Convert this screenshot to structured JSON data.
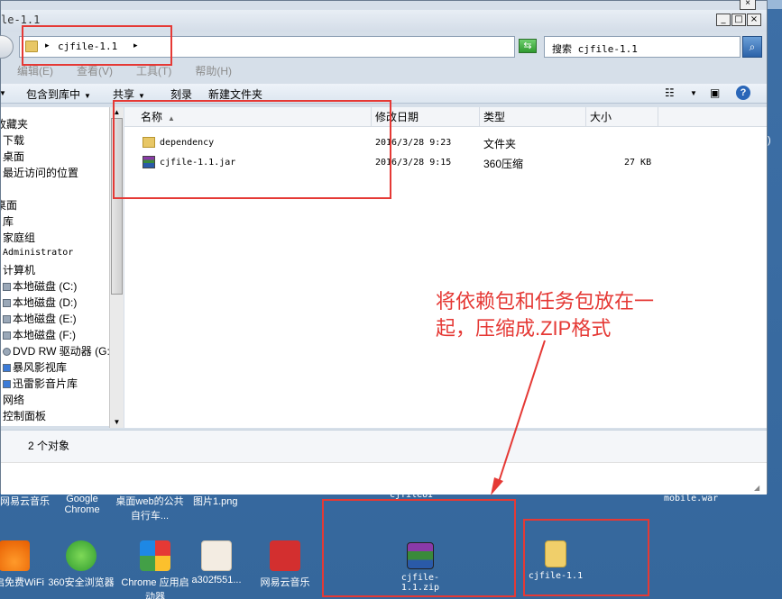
{
  "window": {
    "title": "le-1.1",
    "controls": [
      "_",
      "□",
      "×"
    ],
    "outer_close": "×"
  },
  "address": {
    "path": "cjfile-1.1",
    "search_placeholder": "搜索 cjfile-1.1"
  },
  "menu": [
    "编辑(E)",
    "查看(V)",
    "工具(T)",
    "帮助(H)"
  ],
  "toolbar": {
    "include_library": "包含到库中",
    "share": "共享",
    "burn": "刻录",
    "new_folder": "新建文件夹"
  },
  "nav": {
    "items": [
      {
        "label": "收藏夹"
      },
      {
        "label": "下载"
      },
      {
        "label": "桌面"
      },
      {
        "label": "最近访问的位置"
      },
      {
        "label": "桌面"
      },
      {
        "label": "库"
      },
      {
        "label": "家庭组"
      },
      {
        "label": "Administrator"
      },
      {
        "label": "计算机"
      },
      {
        "label": "本地磁盘 (C:)"
      },
      {
        "label": "本地磁盘 (D:)"
      },
      {
        "label": "本地磁盘 (E:)"
      },
      {
        "label": "本地磁盘 (F:)"
      },
      {
        "label": "DVD RW 驱动器 (G:)"
      },
      {
        "label": "暴风影视库"
      },
      {
        "label": "迅雷影音片库"
      },
      {
        "label": "网络"
      },
      {
        "label": "控制面板"
      }
    ]
  },
  "columns": {
    "name": "名称",
    "modified": "修改日期",
    "type": "类型",
    "size": "大小"
  },
  "files": [
    {
      "name": "dependency",
      "modified": "2016/3/28 9:23",
      "type": "文件夹",
      "size": ""
    },
    {
      "name": "cjfile-1.1.jar",
      "modified": "2016/3/28 9:15",
      "type": "360压缩",
      "size": "27 KB"
    }
  ],
  "status": {
    "count": "2 个对象"
  },
  "annotation": {
    "line1": "将依赖包和任务包放在一",
    "line2": "起，压缩成.ZIP格式"
  },
  "desktop": {
    "top_labels": [
      "网易云音乐",
      "Google Chrome",
      "桌面web的公共自行车...",
      "图片1.png",
      "cjfileUI",
      "mobile.war"
    ],
    "icons": [
      {
        "label": "开启免费WiFi"
      },
      {
        "label": "360安全浏览器"
      },
      {
        "label": "Chrome 应用启动器"
      },
      {
        "label": "a302f551..."
      },
      {
        "label": "网易云音乐"
      },
      {
        "label": "cjfile-1.1.zip"
      },
      {
        "label": "cjfile-1.1"
      }
    ]
  },
  "colors": {
    "desktop": "#3a6ea5",
    "annotation_red": "#e53935"
  }
}
